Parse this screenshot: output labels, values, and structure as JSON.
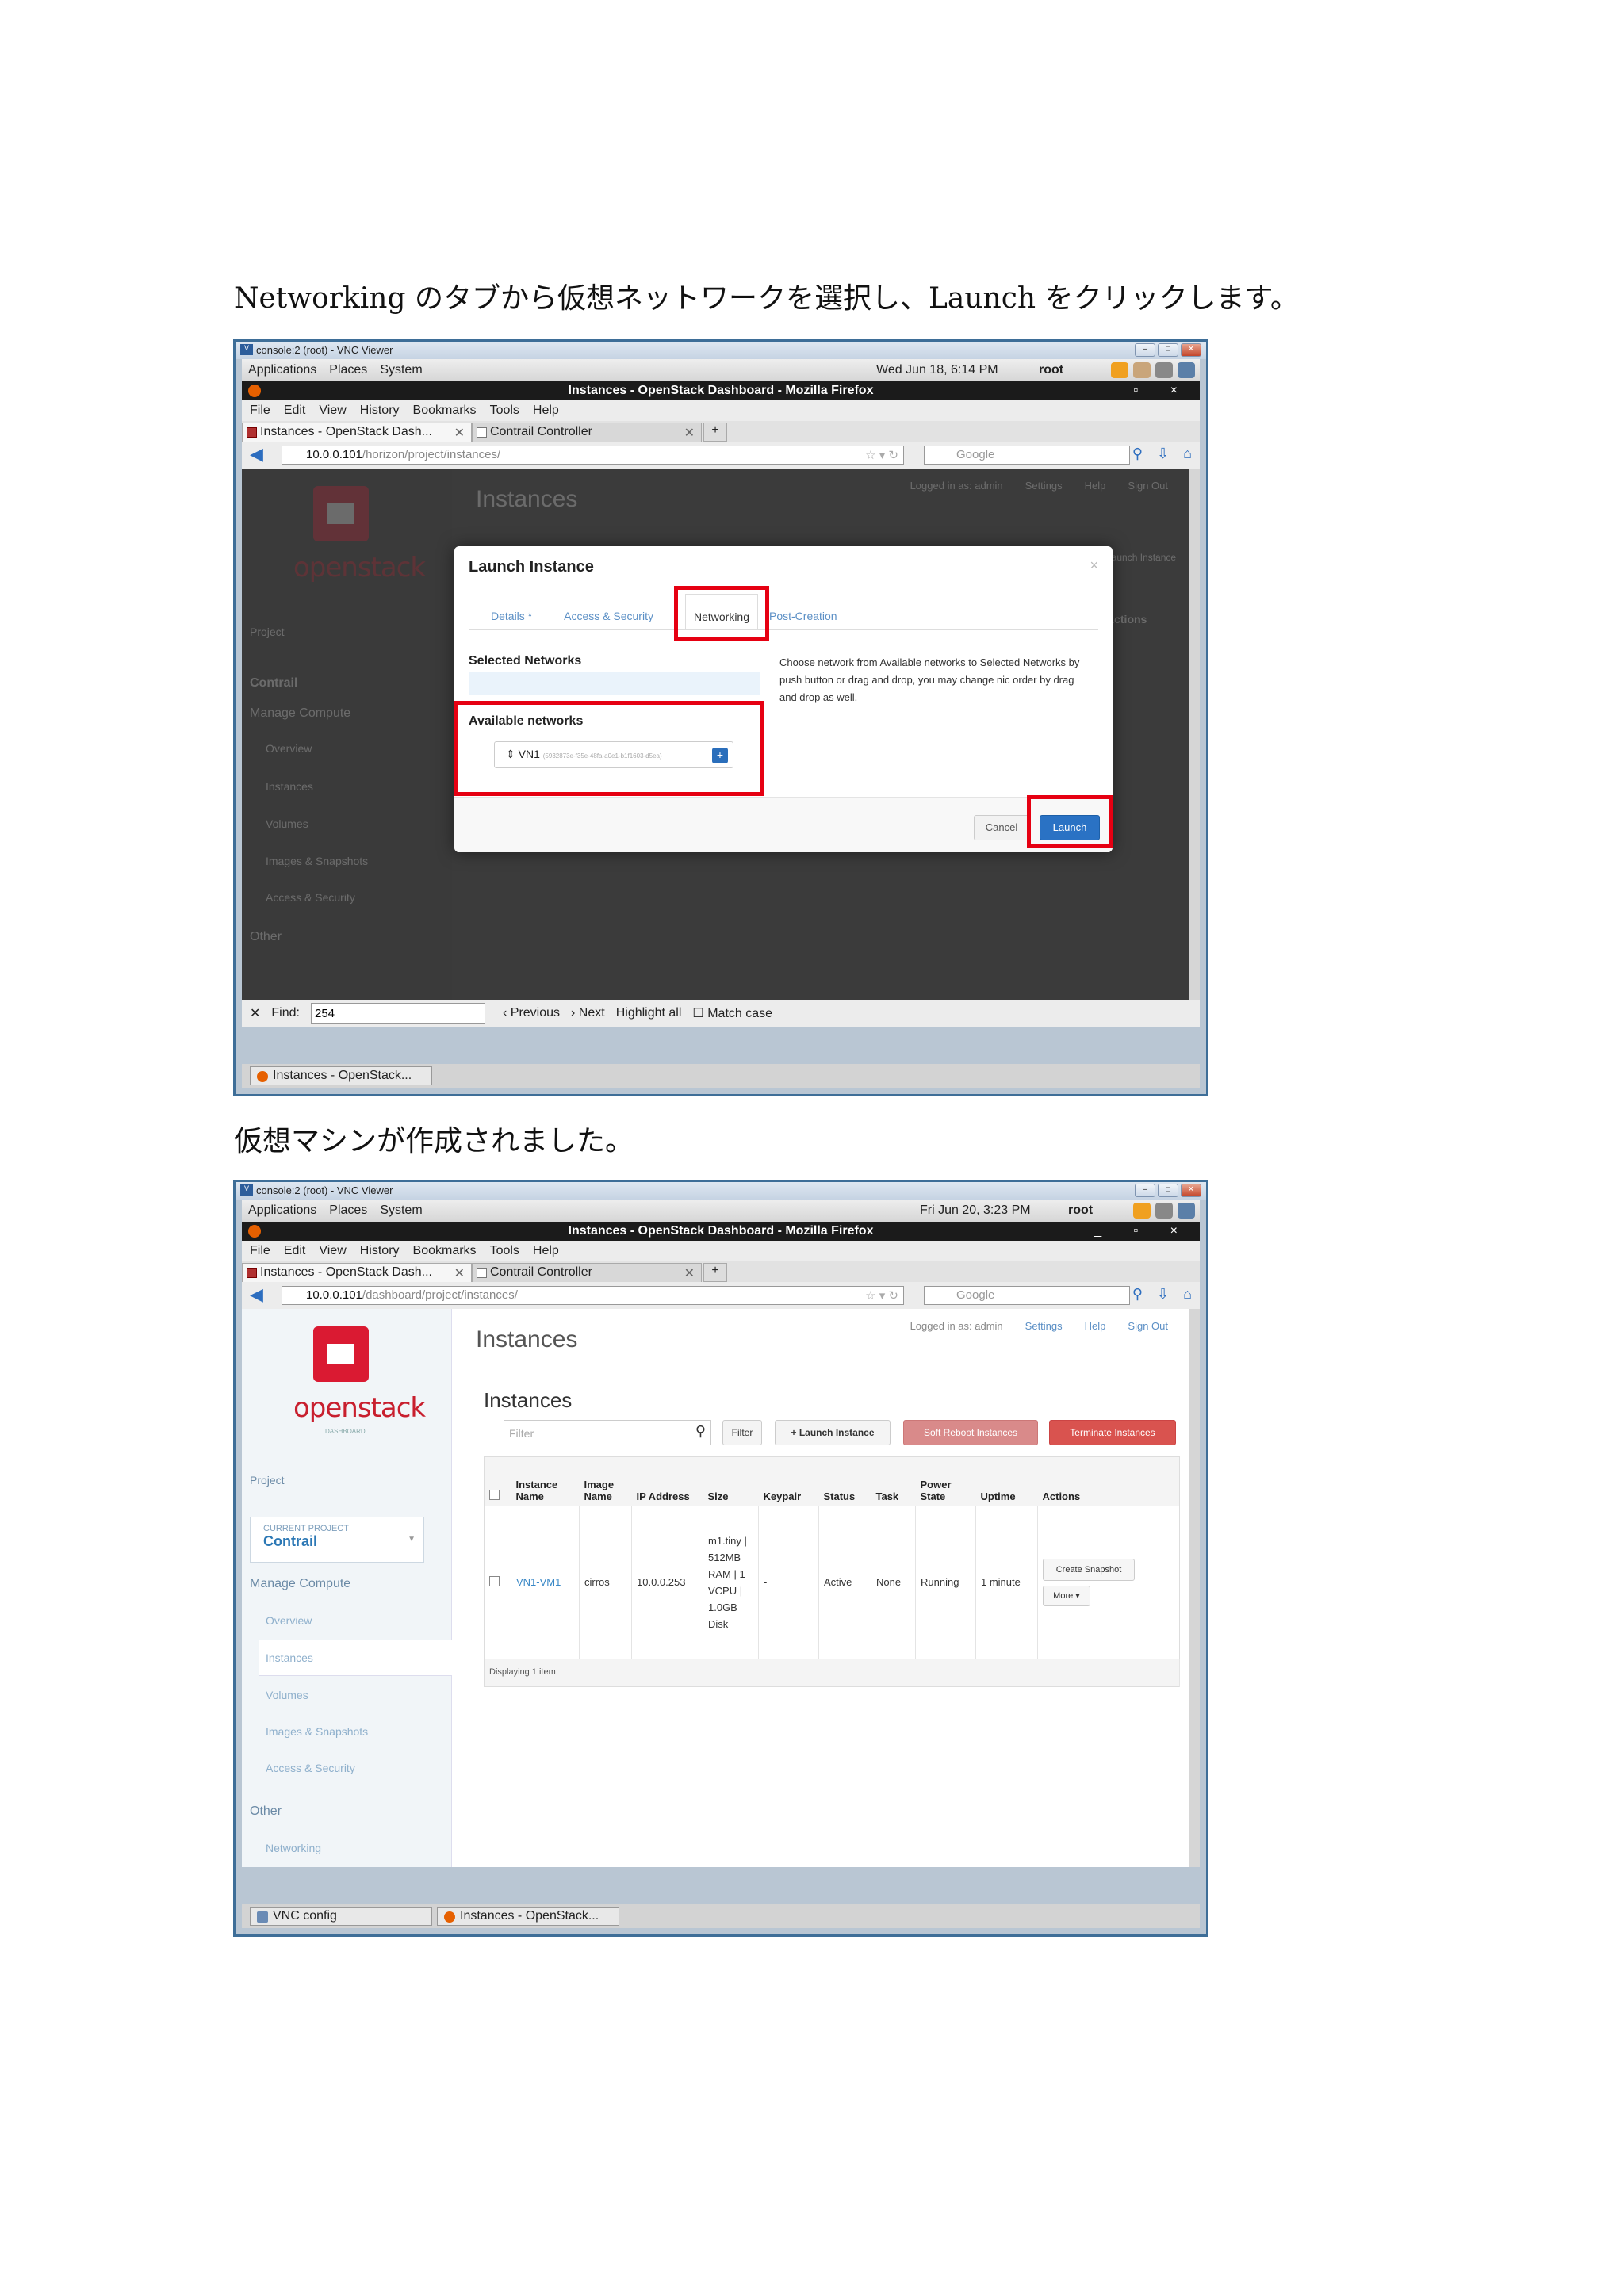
{
  "doc": {
    "para1": "Networking のタブから仮想ネットワークを選択し、Launch をクリックします。",
    "para2": "仮想マシンが作成されました。"
  },
  "common": {
    "vnc_title": "console:2 (root) - VNC Viewer",
    "panel_menus": [
      "Applications",
      "Places",
      "System"
    ],
    "user": "root",
    "window_title": "Instances - OpenStack Dashboard - Mozilla Firefox",
    "menus": [
      "File",
      "Edit",
      "View",
      "History",
      "Bookmarks",
      "Tools",
      "Help"
    ],
    "tab1": "Instances - OpenStack Dash...",
    "tab2": "Contrail Controller",
    "search_placeholder": "Google",
    "task_firefox": "Instances - OpenStack..."
  },
  "shot1": {
    "clock": "Wed Jun 18,  6:14 PM",
    "url_host": "10.0.0.101",
    "url_path": "/horizon/project/instances/",
    "find_label": "Find:",
    "find_value": "254",
    "find_prev": "Previous",
    "find_next": "Next",
    "find_highlight": "Highlight all",
    "find_match": "Match case",
    "bg_title": "Instances",
    "bg_links": [
      "Logged in as: admin",
      "Settings",
      "Help",
      "Sign Out"
    ],
    "bg_sidebar": [
      "Project",
      "Contrail",
      "Manage Compute",
      "Overview",
      "Instances",
      "Volumes",
      "Images & Snapshots",
      "Access & Security",
      "Other"
    ],
    "bg_btn": "Launch Instance",
    "bg_actions": "Actions",
    "modal": {
      "title": "Launch Instance",
      "close": "×",
      "tabs": [
        "Details *",
        "Access & Security",
        "Networking",
        "Post-Creation"
      ],
      "selected_label": "Selected Networks",
      "available_label": "Available networks",
      "net_name": "VN1",
      "net_id": "(5932873e-f35e-48fa-a0e1-b1f1603-d5ea)",
      "net_add": "+",
      "help": "Choose network from Available networks to Selected Networks by push button or drag and drop, you may change nic order by drag and drop as well.",
      "cancel": "Cancel",
      "launch": "Launch"
    }
  },
  "shot2": {
    "clock": "Fri Jun 20,  3:23 PM",
    "url_host": "10.0.0.101",
    "url_path": "/dashboard/project/instances/",
    "task_vnc": "VNC config",
    "logo_word": "openstack",
    "logo_sub": "DASHBOARD",
    "sidebar": {
      "project": "Project",
      "current_label": "CURRENT PROJECT",
      "current_value": "Contrail",
      "manage": "Manage Compute",
      "items": [
        "Overview",
        "Instances",
        "Volumes",
        "Images & Snapshots",
        "Access & Security"
      ],
      "other": "Other",
      "networking": "Networking"
    },
    "page_title": "Instances",
    "top_links": [
      "Logged in as: admin",
      "Settings",
      "Help",
      "Sign Out"
    ],
    "table_title": "Instances",
    "filter_placeholder": "Filter",
    "filter_btn": "Filter",
    "launch_btn": "+ Launch Instance",
    "soft_reboot_btn": "Soft Reboot Instances",
    "terminate_btn": "Terminate Instances",
    "columns": [
      "Instance Name",
      "Image Name",
      "IP Address",
      "Size",
      "Keypair",
      "Status",
      "Task",
      "Power State",
      "Uptime",
      "Actions"
    ],
    "row": {
      "name": "VN1-VM1",
      "image": "cirros",
      "ip": "10.0.0.253",
      "size": "m1.tiny | 512MB RAM | 1 VCPU | 1.0GB Disk",
      "keypair": "-",
      "status": "Active",
      "task": "None",
      "power": "Running",
      "uptime": "1 minute",
      "action1": "Create Snapshot",
      "action2": "More"
    },
    "footer": "Displaying 1 item"
  }
}
